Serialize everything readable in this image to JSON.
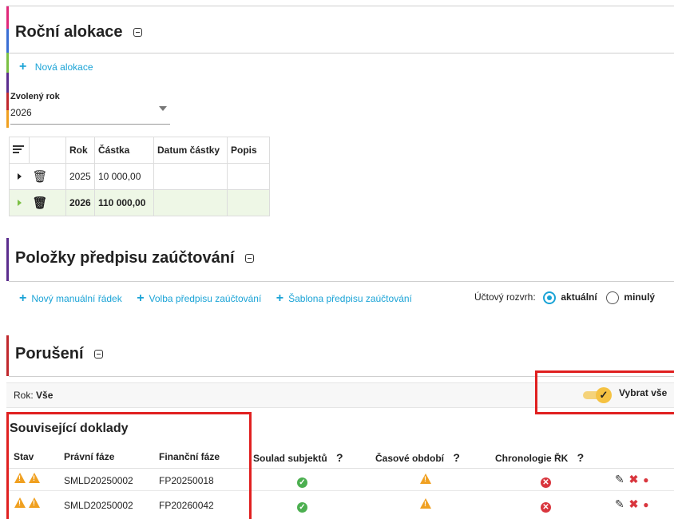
{
  "alokace": {
    "title": "Roční alokace",
    "new_label": "Nová alokace",
    "year_label": "Zvolený rok",
    "year_value": "2026",
    "columns": [
      "Rok",
      "Částka",
      "Datum částky",
      "Popis"
    ],
    "rows": [
      {
        "rok": "2025",
        "castka": "10 000,00",
        "datum": "",
        "popis": ""
      },
      {
        "rok": "2026",
        "castka": "110 000,00",
        "datum": "",
        "popis": ""
      }
    ]
  },
  "polozky": {
    "title": "Položky předpisu zaúčtování",
    "actions": [
      "Nový manuální řádek",
      "Volba předpisu zaúčtování",
      "Šablona předpisu zaúčtování"
    ],
    "rozvrh_label": "Účtový rozvrh:",
    "rozvrh_current": "aktuální",
    "rozvrh_prev": "minulý"
  },
  "poruseni": {
    "title": "Porušení",
    "rok_label": "Rok:",
    "rok_value": "Vše",
    "select_all": "Vybrat vše"
  },
  "doklady": {
    "title": "Související doklady",
    "headers": {
      "stav": "Stav",
      "pravni": "Právní fáze",
      "financni": "Finanční fáze",
      "soulad": "Soulad subjektů",
      "casove": "Časové období",
      "chrono": "Chronologie ŘK",
      "help": "?"
    },
    "rows": [
      {
        "pravni": "SMLD20250002",
        "financni": "FP20250018"
      },
      {
        "pravni": "SMLD20250002",
        "financni": "FP20260042"
      }
    ]
  },
  "colors": {
    "accent": "#1aa3d6",
    "bar_pink": "#e0287a",
    "bar_blue": "#3b6fd4",
    "bar_green": "#7bc043",
    "bar_purple": "#5b2d8e",
    "bar_red": "#c0282d",
    "bar_orange": "#f0a020",
    "toggle": "#f5c242",
    "highlight_box": "#e02020"
  }
}
